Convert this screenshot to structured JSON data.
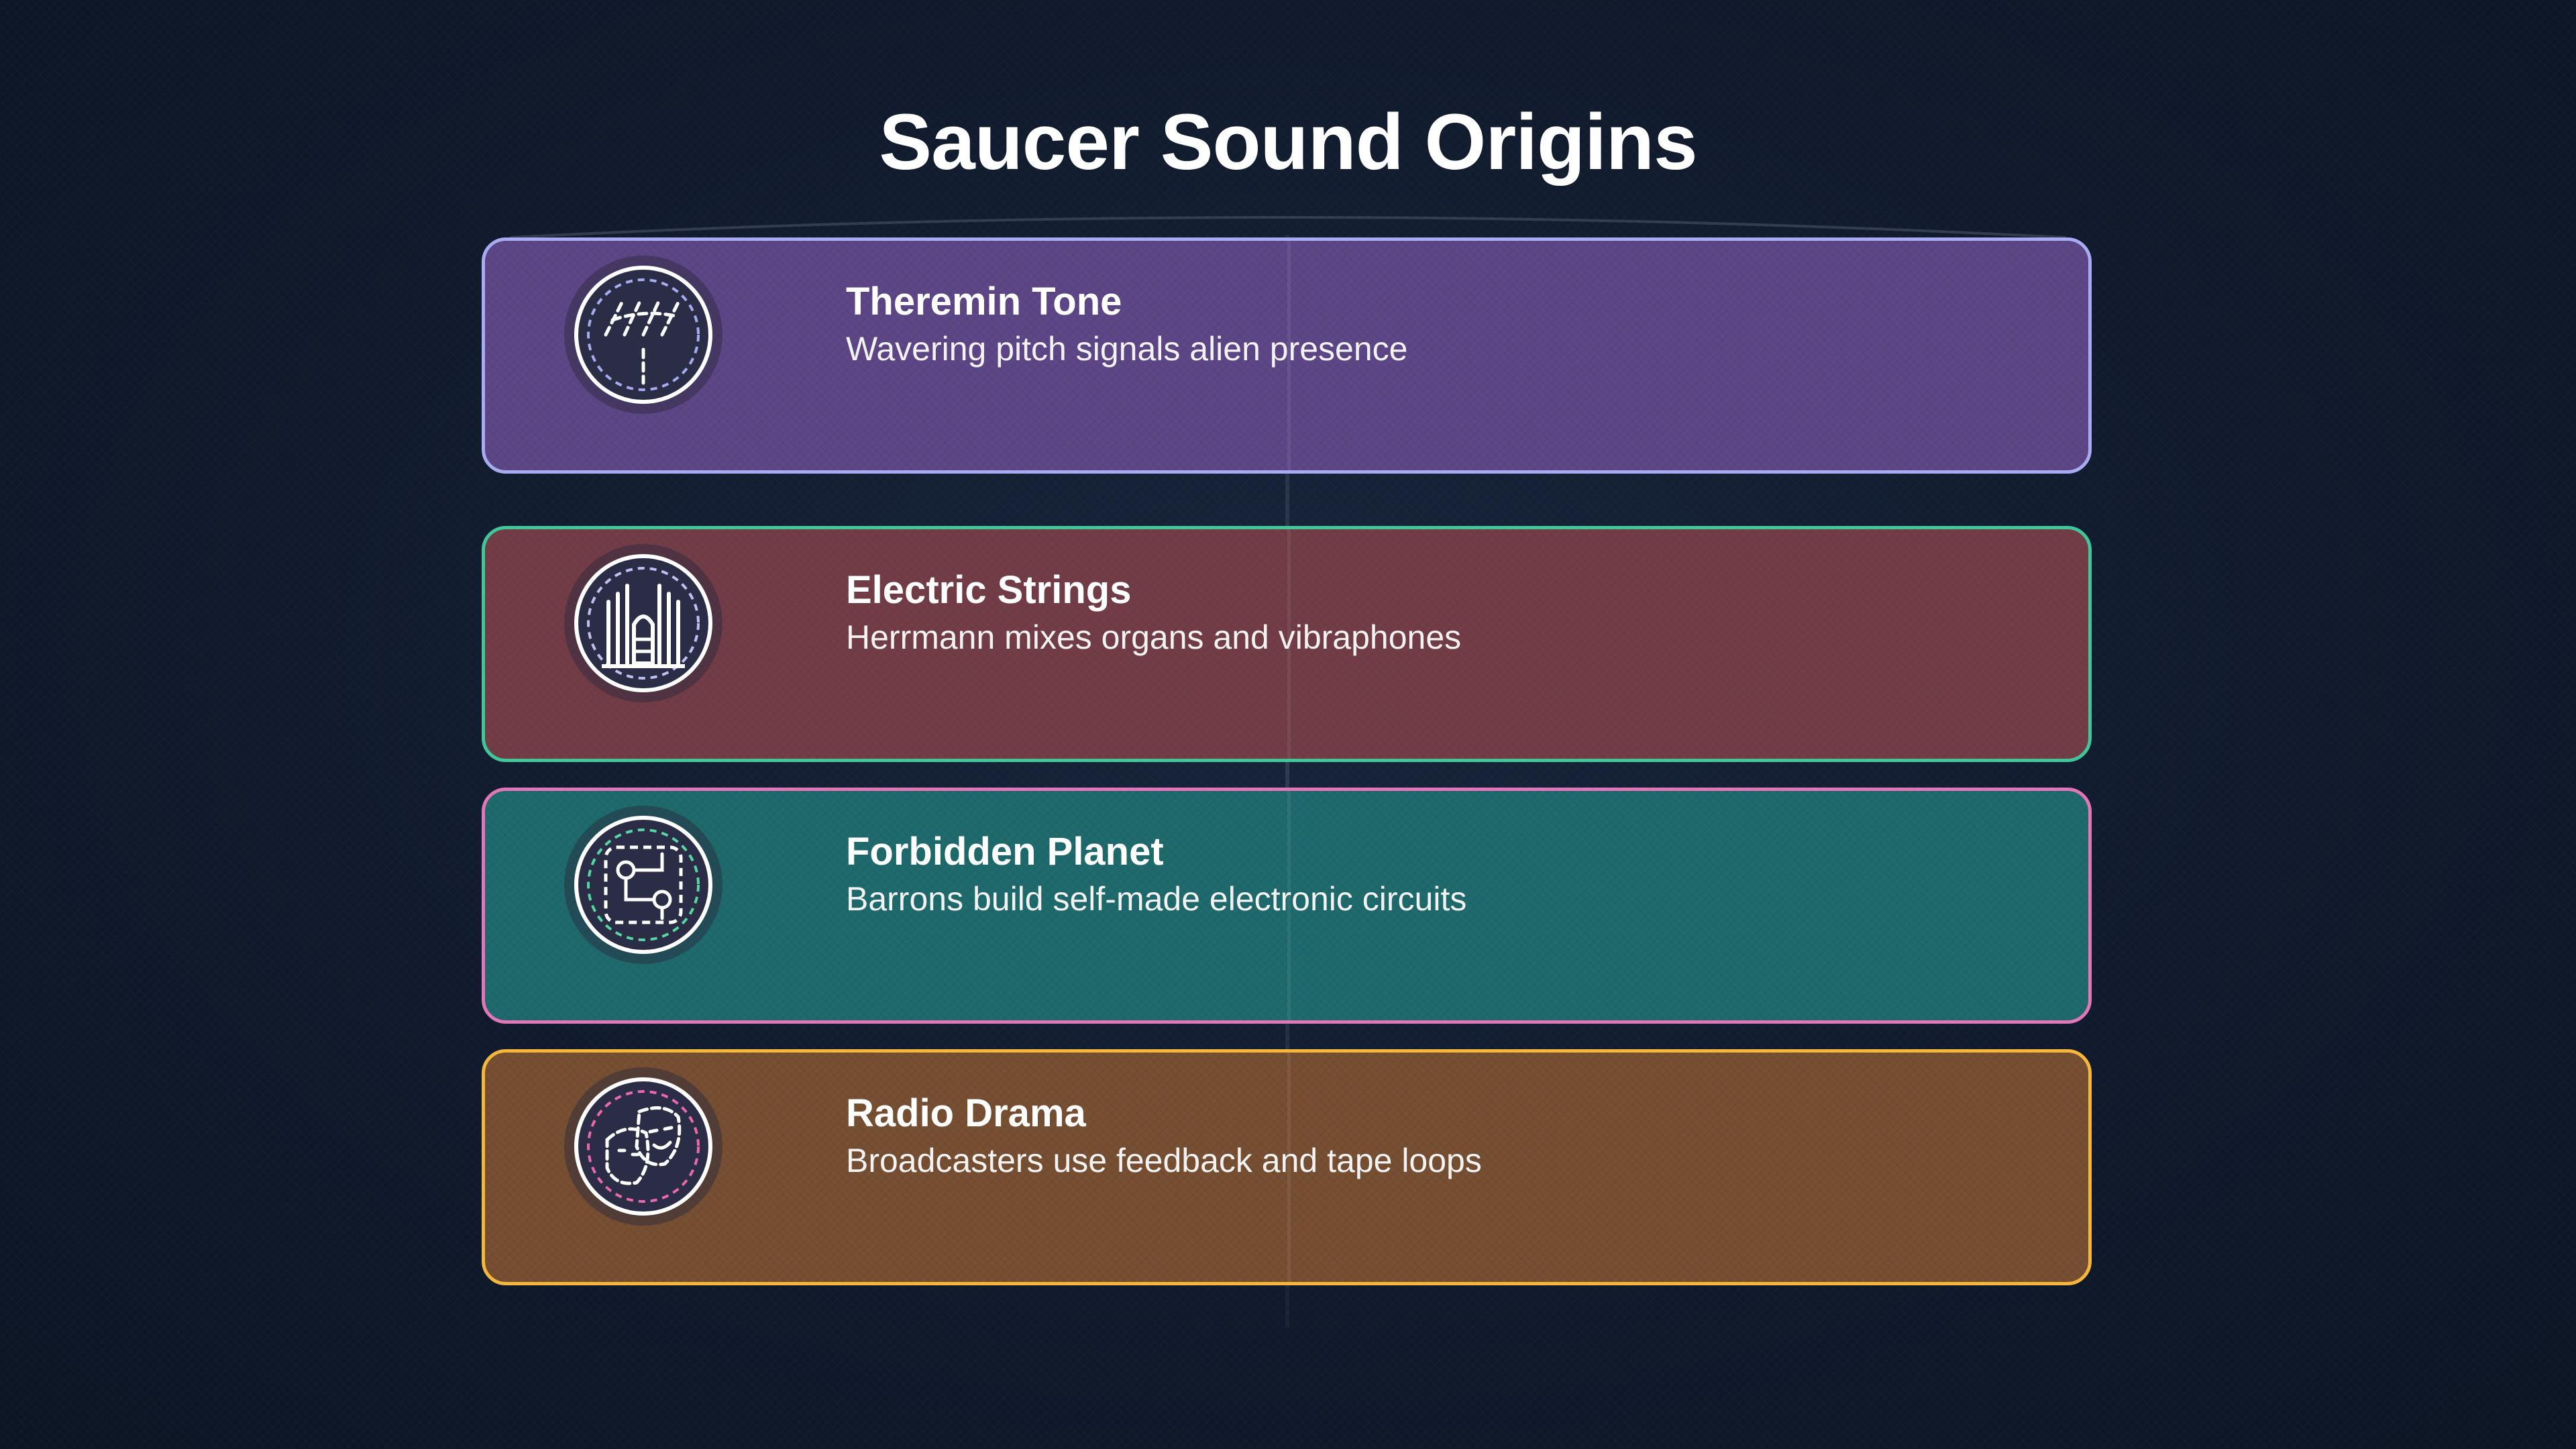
{
  "title": "Saucer Sound Origins",
  "cards": [
    {
      "title": "Theremin Tone",
      "description": "Wavering pitch signals alien presence",
      "icon": "theremin-waves-icon",
      "fill": "#5d4786",
      "border": "#a7abef",
      "accent": "#a7abef"
    },
    {
      "title": "Electric Strings",
      "description": "Herrmann mixes organs and vibraphones",
      "icon": "pipe-organ-icon",
      "fill": "#733d48",
      "border": "#3fc79a",
      "accent": "#c2bff0"
    },
    {
      "title": "Forbidden Planet",
      "description": "Barrons build self-made electronic circuits",
      "icon": "circuit-icon",
      "fill": "#1f6a6c",
      "border": "#e376b8",
      "accent": "#55d6a2"
    },
    {
      "title": "Radio Drama",
      "description": "Broadcasters use feedback and tape loops",
      "icon": "theater-masks-icon",
      "fill": "#774f33",
      "border": "#f4b73c",
      "accent": "#e86aa8"
    }
  ]
}
